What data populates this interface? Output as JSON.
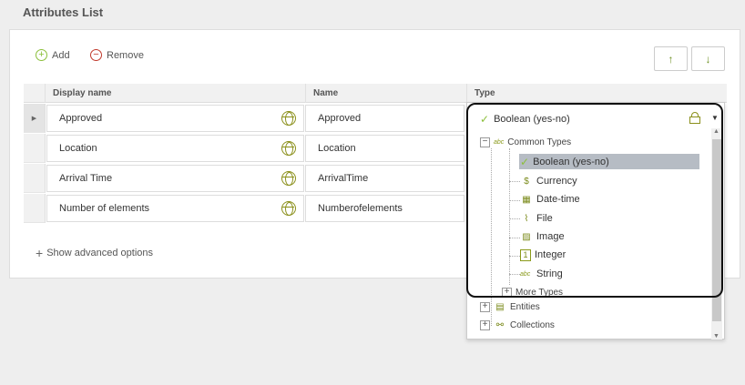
{
  "page": {
    "title": "Attributes List"
  },
  "toolbar": {
    "add_label": "Add",
    "remove_label": "Remove",
    "move_up": "↑",
    "move_down": "↓"
  },
  "grid": {
    "columns": [
      "Display name",
      "Name",
      "Type"
    ],
    "rows": [
      {
        "display_name": "Approved",
        "name": "Approved"
      },
      {
        "display_name": "Location",
        "name": "Location"
      },
      {
        "display_name": "Arrival Time",
        "name": "ArrivalTime"
      },
      {
        "display_name": "Number of elements",
        "name": "Numberofelements"
      }
    ]
  },
  "advanced": {
    "label": "Show advanced options"
  },
  "type_dropdown": {
    "selected": "Boolean (yes-no)",
    "groups": {
      "common": "Common Types",
      "more": "More Types",
      "entities": "Entities",
      "collections": "Collections"
    },
    "items": [
      "Boolean (yes-no)",
      "Currency",
      "Date-time",
      "File",
      "Image",
      "Integer",
      "String"
    ]
  },
  "colors": {
    "accent": "#8bbf3a",
    "remove": "#c0392b",
    "highlight": "#b6bcc4"
  }
}
